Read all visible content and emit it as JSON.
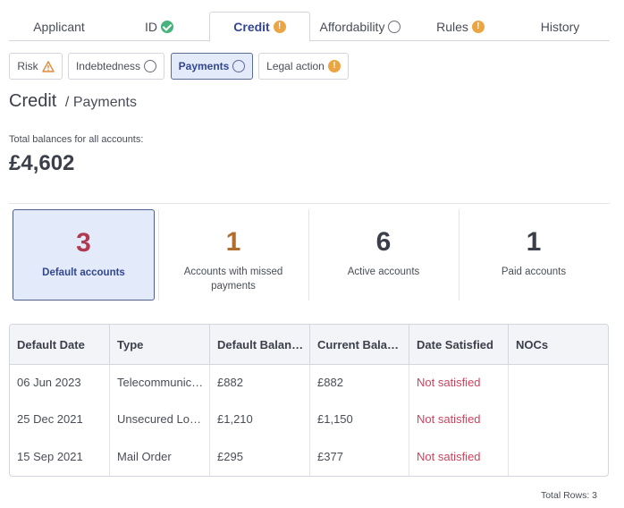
{
  "tabs": [
    {
      "label": "Applicant",
      "icon": ""
    },
    {
      "label": "ID",
      "icon": "check-circle-icon"
    },
    {
      "label": "Credit",
      "icon": "warning-circle-icon"
    },
    {
      "label": "Affordability",
      "icon": "empty-circle-icon"
    },
    {
      "label": "Rules",
      "icon": "warning-circle-icon"
    },
    {
      "label": "History",
      "icon": ""
    }
  ],
  "subtabs": [
    {
      "label": "Risk",
      "icon": "warning-triangle-icon"
    },
    {
      "label": "Indebtedness",
      "icon": "empty-circle-icon"
    },
    {
      "label": "Payments",
      "icon": "empty-circle-icon"
    },
    {
      "label": "Legal action",
      "icon": "warning-circle-icon"
    }
  ],
  "header": {
    "title": "Credit",
    "subtitle": "/ Payments"
  },
  "totals": {
    "label": "Total balances for all accounts:",
    "value": "£4,602"
  },
  "stats": [
    {
      "value": "3",
      "caption": "Default accounts",
      "color": "#b03a4f"
    },
    {
      "value": "1",
      "caption": "Accounts with missed payments",
      "color": "#b06d2c"
    },
    {
      "value": "6",
      "caption": "Active accounts",
      "color": "#3c3f4a"
    },
    {
      "value": "1",
      "caption": "Paid accounts",
      "color": "#3c3f4a"
    }
  ],
  "table": {
    "columns": [
      "Default Date",
      "Type",
      "Default Balan…",
      "Current Bala…",
      "Date Satisfied",
      "NOCs"
    ],
    "rows": [
      [
        "06 Jun 2023",
        "Telecommunic…",
        "£882",
        "£882",
        "Not satisfied",
        ""
      ],
      [
        "25 Dec 2021",
        "Unsecured Lo…",
        "£1,210",
        "£1,150",
        "Not satisfied",
        ""
      ],
      [
        "15 Sep 2021",
        "Mail Order",
        "£295",
        "£377",
        "Not satisfied",
        ""
      ]
    ],
    "footer": "Total Rows: 3"
  },
  "colors": {
    "accent": "#33478f",
    "active_bg": "#e3ebfb",
    "warning": "#eba543",
    "success": "#47b27b",
    "error": "#d2405c"
  }
}
